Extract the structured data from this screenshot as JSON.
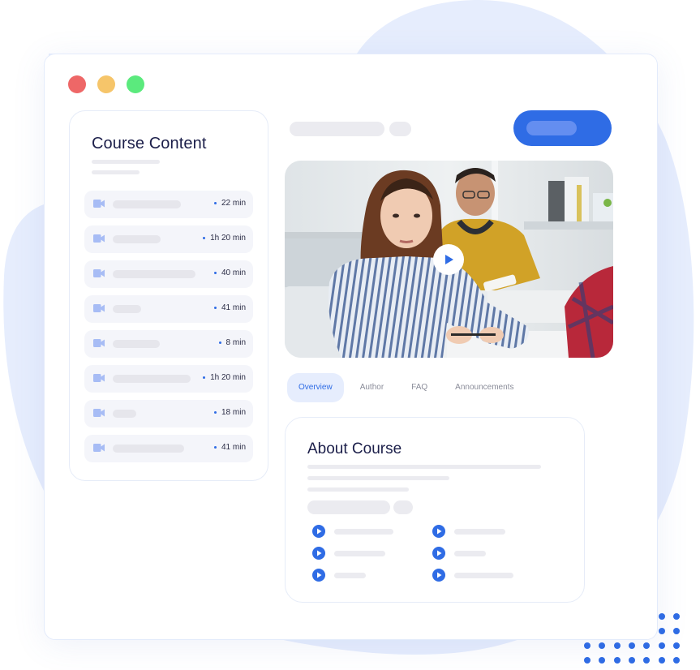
{
  "theme": {
    "accent": "#2f6ce5",
    "accent_light": "#648ef0",
    "tab_active_bg": "#e6edfd",
    "blob": "#e6edfd",
    "skeleton": "#ebebf0",
    "heading": "#1c1f4a"
  },
  "window": {
    "controls": [
      {
        "name": "close",
        "color": "#ee6767"
      },
      {
        "name": "minimize",
        "color": "#f6c56a"
      },
      {
        "name": "maximize",
        "color": "#5bea7d"
      }
    ]
  },
  "sidebar": {
    "title": "Course Content",
    "lessons": [
      {
        "icon": "video-camera-icon",
        "duration": "22 min"
      },
      {
        "icon": "video-camera-icon",
        "duration": "1h 20 min"
      },
      {
        "icon": "video-camera-icon",
        "duration": "40 min"
      },
      {
        "icon": "video-camera-icon",
        "duration": "41 min"
      },
      {
        "icon": "video-camera-icon",
        "duration": "8 min"
      },
      {
        "icon": "video-camera-icon",
        "duration": "1h 20 min"
      },
      {
        "icon": "video-camera-icon",
        "duration": "18 min"
      },
      {
        "icon": "video-camera-icon",
        "duration": "41 min"
      }
    ]
  },
  "video": {
    "play_icon": "play-icon",
    "description": "classroom photo of students"
  },
  "tabs": [
    {
      "label": "Overview",
      "active": true
    },
    {
      "label": "Author",
      "active": false
    },
    {
      "label": "FAQ",
      "active": false
    },
    {
      "label": "Announcements",
      "active": false
    }
  ],
  "about": {
    "title": "About Course",
    "features": [
      {
        "icon": "play-circle-icon"
      },
      {
        "icon": "play-circle-icon"
      },
      {
        "icon": "play-circle-icon"
      },
      {
        "icon": "play-circle-icon"
      },
      {
        "icon": "play-circle-icon"
      },
      {
        "icon": "play-circle-icon"
      }
    ]
  }
}
